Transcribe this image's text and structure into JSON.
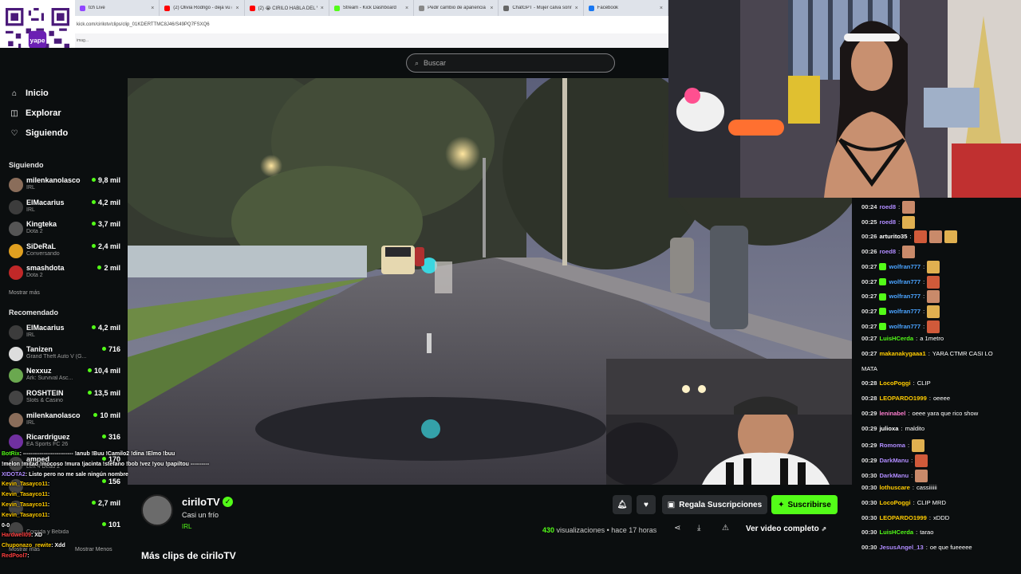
{
  "browser": {
    "tabs": [
      {
        "label": "tch Live",
        "color": "#9146ff"
      },
      {
        "label": "(2) Olivia Rodrigo - deja vu (O",
        "color": "#ff0000"
      },
      {
        "label": "(2) 😭 CIRILO HABLA DEL VIA",
        "color": "#ff0000"
      },
      {
        "label": "Stream - Kick Dashboard",
        "color": "#53fc18"
      },
      {
        "label": "Pedir cambio de apariencia",
        "color": "#888888"
      },
      {
        "label": "ChatGPT - Mujer calva sonrie",
        "color": "#666666"
      },
      {
        "label": "Facebook",
        "color": "#1877f2"
      }
    ],
    "close_glyph": "×",
    "url": "kick.com/cirilotv/clips/clip_01KDERTTMC8J46/S49PQ7FSXQ6",
    "bookmark": "imag..."
  },
  "search": {
    "placeholder": "Buscar",
    "icon": "search-icon"
  },
  "nav": [
    {
      "label": "Inicio",
      "icon": "home-icon",
      "glyph": "⌂"
    },
    {
      "label": "Explorar",
      "icon": "compass-icon",
      "glyph": "◫"
    },
    {
      "label": "Siguiendo",
      "icon": "heart-icon",
      "glyph": "♡"
    }
  ],
  "following": {
    "title": "Siguiendo",
    "channels": [
      {
        "name": "milenkanolasco",
        "game": "IRL",
        "count": "9,8 mil",
        "color": "#8a6d5a"
      },
      {
        "name": "ElMacarius",
        "game": "IRL",
        "count": "4,2 mil",
        "color": "#3c3c3c"
      },
      {
        "name": "Kingteka",
        "game": "Dota 2",
        "count": "3,7 mil",
        "color": "#555555"
      },
      {
        "name": "SiDeRaL",
        "game": "Conversando",
        "count": "2,4 mil",
        "color": "#e0a020"
      },
      {
        "name": "smashdota",
        "game": "Dota 2",
        "count": "2 mil",
        "color": "#c02828"
      }
    ],
    "more": "Mostrar más"
  },
  "recommended": {
    "title": "Recomendado",
    "channels": [
      {
        "name": "ElMacarius",
        "game": "IRL",
        "count": "4,2 mil",
        "color": "#3c3c3c"
      },
      {
        "name": "Tanizen",
        "game": "Grand Theft Auto V (G...",
        "count": "716",
        "color": "#dddddd"
      },
      {
        "name": "Nexxuz",
        "game": "Ark: Survival Asc...",
        "count": "10,4 mil",
        "color": "#6aa84f"
      },
      {
        "name": "ROSHTEIN",
        "game": "Slots & Casino",
        "count": "13,5 mil",
        "color": "#444444"
      },
      {
        "name": "milenkanolasco",
        "game": "IRL",
        "count": "10 mil",
        "color": "#8a6d5a"
      },
      {
        "name": "Ricardriguez",
        "game": "EA Sports FC 26",
        "count": "316",
        "color": "#7030a0"
      },
      {
        "name": "amped",
        "game": "Left 4 Dead 2",
        "count": "170",
        "color": "#444444"
      },
      {
        "name": "",
        "game": "",
        "count": "156",
        "color": "#444444"
      },
      {
        "name": "",
        "game": "",
        "count": "2,7 mil",
        "color": "#444444"
      },
      {
        "name": "",
        "game": "Comida y Bebida",
        "count": "101",
        "color": "#444444"
      }
    ],
    "more": "Mostrar más",
    "less": "Mostrar Menos"
  },
  "overlay_chat": [
    {
      "user": "BotRix",
      "text": ": --------------------------- !anub !Buu !Camilo2 !dina !Elmo !buu",
      "color": "#53fc18"
    },
    {
      "user": "",
      "text": "!melon !mitad !mocoso !mura !jacinta !stefano !bob !vez !you !papiltou ----------",
      "color": "#ffffff"
    },
    {
      "user": "XIDOTA2",
      "text": ": Listo pero no me sale ningún nombre",
      "color": "#b08cff"
    },
    {
      "user": "Kevin_Tasayco11",
      "text": ":",
      "color": "#ffcc00"
    },
    {
      "user": "Kevin_Tasayco11",
      "text": ":",
      "color": "#ffcc00"
    },
    {
      "user": "Kevin_Tasayco11",
      "text": ":",
      "color": "#ffcc00"
    },
    {
      "user": "Kevin_Tasayco11",
      "text": ":",
      "color": "#ffcc00"
    },
    {
      "user": "",
      "text": "0-0",
      "color": "#ffffff"
    },
    {
      "user": "Hardwell09",
      "text": ": XD",
      "color": "#ff4040"
    },
    {
      "user": "Chuponazo_rewite",
      "text": ": Xdd",
      "color": "#ffcc00"
    },
    {
      "user": "RedPool7",
      "text": ":",
      "color": "#ff4040"
    }
  ],
  "clip": {
    "streamer": "ciriloTV",
    "title": "Casi un frío",
    "category": "IRL",
    "views_count": "430",
    "views_label": "visualizaciones",
    "age": "hace 17 horas",
    "gift_label": "Regala Suscripciones",
    "subscribe_label": "Suscribirse",
    "full_video_label": "Ver video completo",
    "more_clips": "Más clips de ciriloTV"
  },
  "chat": [
    {
      "t": "00:24",
      "u": "roed8",
      "c": "#b08cff",
      "text": "",
      "emotes": 1,
      "sub": false
    },
    {
      "t": "00:25",
      "u": "roed8",
      "c": "#b08cff",
      "text": "",
      "emotes": 1,
      "sub": false
    },
    {
      "t": "00:26",
      "u": "arturito35",
      "c": "#ffffff",
      "text": "",
      "emotes": 3,
      "sub": false
    },
    {
      "t": "00:26",
      "u": "roed8",
      "c": "#b08cff",
      "text": "",
      "emotes": 1,
      "sub": false
    },
    {
      "t": "00:27",
      "u": "wolfran777",
      "c": "#4aa3ff",
      "text": "",
      "emotes": 1,
      "sub": true
    },
    {
      "t": "00:27",
      "u": "wolfran777",
      "c": "#4aa3ff",
      "text": "",
      "emotes": 1,
      "sub": true
    },
    {
      "t": "00:27",
      "u": "wolfran777",
      "c": "#4aa3ff",
      "text": "",
      "emotes": 1,
      "sub": true
    },
    {
      "t": "00:27",
      "u": "wolfran777",
      "c": "#4aa3ff",
      "text": "",
      "emotes": 1,
      "sub": true
    },
    {
      "t": "00:27",
      "u": "wolfran777",
      "c": "#4aa3ff",
      "text": "",
      "emotes": 1,
      "sub": true
    },
    {
      "t": "00:27",
      "u": "LuisHCerda",
      "c": "#53fc18",
      "text": "a 1metro",
      "emotes": 0,
      "sub": false
    },
    {
      "t": "00:27",
      "u": "makanakygaaa1",
      "c": "#ffcc00",
      "text": "YARA CTMR CASI LO",
      "emotes": 0,
      "sub": false
    },
    {
      "t": "",
      "u": "",
      "c": "#ffffff",
      "text": "MATA",
      "emotes": 0,
      "sub": false
    },
    {
      "t": "00:28",
      "u": "LocoPoggi",
      "c": "#ffcc00",
      "text": "CLIP",
      "emotes": 0,
      "sub": false
    },
    {
      "t": "00:28",
      "u": "LEOPARDO1999",
      "c": "#ffcc00",
      "text": "oeeee",
      "emotes": 0,
      "sub": false
    },
    {
      "t": "00:29",
      "u": "leninabel",
      "c": "#ff7fd0",
      "text": "oeee yara que rico show",
      "emotes": 0,
      "sub": false
    },
    {
      "t": "00:29",
      "u": "julioxa",
      "c": "#ffffff",
      "text": "maldito",
      "emotes": 0,
      "sub": false
    },
    {
      "t": "00:29",
      "u": "Romoma",
      "c": "#b08cff",
      "text": "",
      "emotes": 1,
      "sub": false
    },
    {
      "t": "00:29",
      "u": "DarkManu",
      "c": "#b08cff",
      "text": "",
      "emotes": 1,
      "sub": false
    },
    {
      "t": "00:30",
      "u": "DarkManu",
      "c": "#b08cff",
      "text": "",
      "emotes": 1,
      "sub": false
    },
    {
      "t": "00:30",
      "u": "lothuscare",
      "c": "#ffcc00",
      "text": "cassiiiiii",
      "emotes": 0,
      "sub": false
    },
    {
      "t": "00:30",
      "u": "LocoPoggi",
      "c": "#ffcc00",
      "text": "CLIP MRD",
      "emotes": 0,
      "sub": false
    },
    {
      "t": "00:30",
      "u": "LEOPARDO1999",
      "c": "#ffcc00",
      "text": "xDDD",
      "emotes": 0,
      "sub": false
    },
    {
      "t": "00:30",
      "u": "LuisHCerda",
      "c": "#53fc18",
      "text": "tarao",
      "emotes": 0,
      "sub": false
    },
    {
      "t": "00:30",
      "u": "JesusAngel_13",
      "c": "#b08cff",
      "text": "oe que fueeeee",
      "emotes": 0,
      "sub": false
    }
  ],
  "colors": {
    "accent": "#53fc18",
    "bg": "#0b0e0f",
    "button": "#2a2d30"
  }
}
